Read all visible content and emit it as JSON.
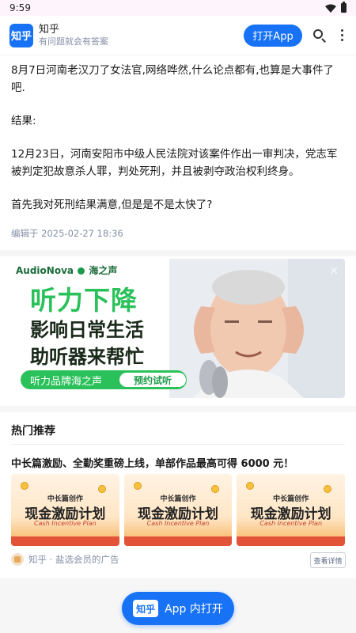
{
  "status_bar": {
    "time": "9:59"
  },
  "header": {
    "logo_text": "知乎",
    "brand_name": "知乎",
    "slogan": "有问题就会有答案",
    "open_app_label": "打开App"
  },
  "article": {
    "paragraphs": [
      "8月7日河南老汉刀了女法官,网络哗然,什么论点都有,也算是大事件了吧.",
      "结果:",
      "12月23日，河南安阳市中级人民法院对该案件作出一审判决，党志军被判定犯故意杀人罪，判处死刑，并且被剥夺政治权利终身。",
      "首先我对死刑结果满意,但是是不是太快了?"
    ],
    "edit_time": "编辑于  2025-02-27  18:36"
  },
  "ad": {
    "brand_left": "AudioNova",
    "brand_right": "海之声",
    "headline": "听力下降",
    "line2": "影响日常生活",
    "line3": "助听器来帮忙",
    "tag": "听力品牌海之声",
    "cta": "预约试听",
    "close": "✕"
  },
  "hot": {
    "title": "热门推荐",
    "promo_text": "中长篇激励、全勤奖重磅上线，单部作品最高可得 6000 元！",
    "cards": [
      {
        "sub": "中长篇创作",
        "main": "现金激励计划",
        "script": "Cash Incentive Plan"
      },
      {
        "sub": "中长篇创作",
        "main": "现金激励计划",
        "script": "Cash Incentive Plan"
      },
      {
        "sub": "中长篇创作",
        "main": "现金激励计划",
        "script": "Cash Incentive Plan"
      }
    ],
    "source": "知乎 · 盐选会员的广告",
    "view_detail": "查看详情"
  },
  "bottom": {
    "logo_text": "知乎",
    "label": "App 内打开"
  },
  "colors": {
    "primary": "#1772f6",
    "ad_green": "#2bc15a",
    "meta_gray": "#8590a6"
  }
}
